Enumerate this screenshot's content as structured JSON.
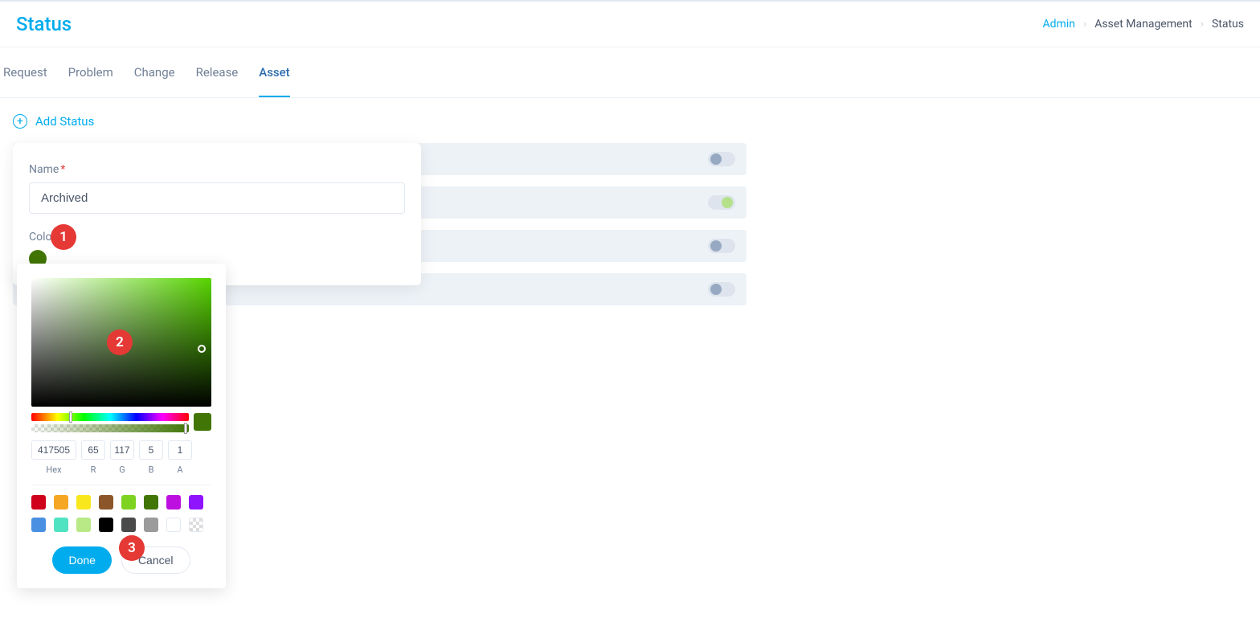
{
  "header": {
    "title": "Status",
    "breadcrumb": {
      "admin": "Admin",
      "asset_mgmt": "Asset Management",
      "status": "Status"
    }
  },
  "tabs": {
    "request": "Request",
    "problem": "Problem",
    "change": "Change",
    "release": "Release",
    "asset": "Asset"
  },
  "add_link": "Add Status",
  "panel": {
    "name_label": "Name",
    "name_value": "Archived",
    "color_label": "Color",
    "swatch_color": "#417505"
  },
  "callouts": {
    "c1": "1",
    "c2": "2",
    "c3": "3"
  },
  "picker": {
    "hex": "417505",
    "r": "65",
    "g": "117",
    "b": "5",
    "a": "1",
    "labels": {
      "hex": "Hex",
      "r": "R",
      "g": "G",
      "b": "B",
      "a": "A"
    },
    "done": "Done",
    "cancel": "Cancel",
    "presets": [
      "#d0021b",
      "#f5a623",
      "#f8e71c",
      "#8b572a",
      "#7ed321",
      "#417505",
      "#bd10e0",
      "#9013fe",
      "#4a90e2",
      "#50e3c2",
      "#b8e986",
      "#000000",
      "#4a4a4a",
      "#9b9b9b",
      "#ffffff"
    ]
  },
  "rows": [
    {
      "on": false
    },
    {
      "on": true
    },
    {
      "on": false
    },
    {
      "on": false
    }
  ]
}
